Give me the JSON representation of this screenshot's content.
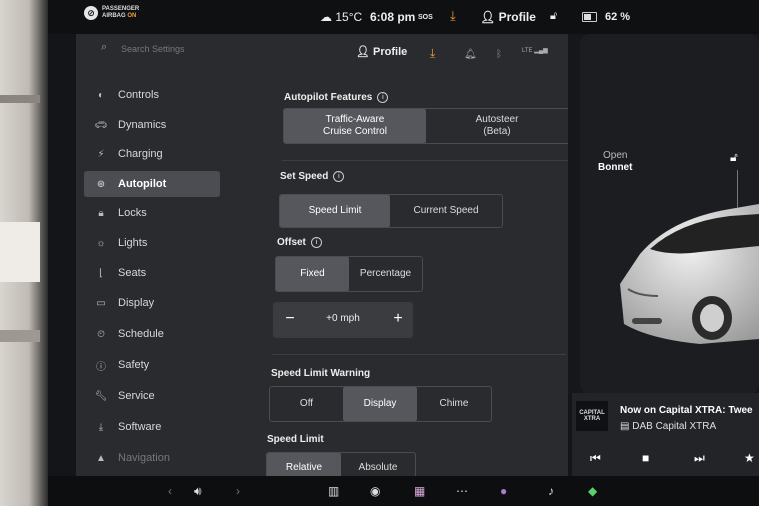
{
  "status_bar": {
    "airbag_line1": "PASSENGER",
    "airbag_line2": "AIRBAG",
    "airbag_state": "ON",
    "temperature": "15°C",
    "time": "6:08 pm",
    "sos": "SOS",
    "profile": "Profile",
    "battery_percent": "62 %"
  },
  "top_bar": {
    "search_placeholder": "Search Settings",
    "profile": "Profile",
    "lte": "LTE"
  },
  "sidebar": {
    "items": [
      {
        "label": "Controls",
        "icon": "toggle-icon"
      },
      {
        "label": "Dynamics",
        "icon": "car-icon"
      },
      {
        "label": "Charging",
        "icon": "bolt-icon"
      },
      {
        "label": "Autopilot",
        "icon": "steering-wheel-icon",
        "active": true
      },
      {
        "label": "Locks",
        "icon": "lock-icon"
      },
      {
        "label": "Lights",
        "icon": "light-icon"
      },
      {
        "label": "Seats",
        "icon": "seat-icon"
      },
      {
        "label": "Display",
        "icon": "display-icon"
      },
      {
        "label": "Schedule",
        "icon": "clock-icon"
      },
      {
        "label": "Safety",
        "icon": "alert-icon"
      },
      {
        "label": "Service",
        "icon": "wrench-icon"
      },
      {
        "label": "Software",
        "icon": "download-icon"
      },
      {
        "label": "Navigation",
        "icon": "navigation-icon"
      }
    ]
  },
  "autopilot_features": {
    "title": "Autopilot Features",
    "options": [
      "Traffic-Aware\nCruise Control",
      "Autosteer\n(Beta)"
    ],
    "selected": "Traffic-Aware Cruise Control"
  },
  "set_speed": {
    "title": "Set Speed",
    "options": [
      "Speed Limit",
      "Current Speed"
    ],
    "selected": "Speed Limit"
  },
  "offset": {
    "title": "Offset",
    "options": [
      "Fixed",
      "Percentage"
    ],
    "selected": "Fixed",
    "value": "+0 mph",
    "minus": "−",
    "plus": "+"
  },
  "speed_limit_warning": {
    "title": "Speed Limit Warning",
    "options": [
      "Off",
      "Display",
      "Chime"
    ],
    "selected": "Display"
  },
  "speed_limit": {
    "title": "Speed Limit",
    "options": [
      "Relative",
      "Absolute"
    ],
    "selected": "Relative"
  },
  "car": {
    "bonnet_line1": "Open",
    "bonnet_line2": "Bonnet"
  },
  "media": {
    "logo": "CAPITAL XTRA",
    "now_playing": "Now on Capital XTRA: Twee",
    "source": "DAB Capital XTRA"
  },
  "colors": {
    "accent_orange": "#f0a03a",
    "panel_bg": "#2a2b2e",
    "selected_bg": "#55575c"
  }
}
